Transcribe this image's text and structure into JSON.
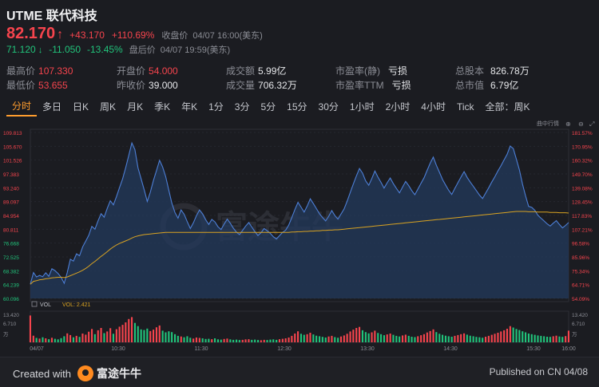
{
  "header": {
    "title": "UTME 联代科技",
    "price": "82.170",
    "change": "+43.170",
    "change_pct": "+110.69%",
    "close_label": "收盘价",
    "close_time": "04/07 16:00(美东)",
    "ah_price": "71.120",
    "ah_change": "-11.050",
    "ah_change_pct": "-13.45%",
    "ah_label": "盘后价",
    "ah_time": "04/07 19:59(美东)"
  },
  "stats": {
    "high_label": "最高价",
    "high": "107.330",
    "low_label": "最低价",
    "low": "53.655",
    "open_label": "开盘价",
    "open": "54.000",
    "prev_label": "昨收价",
    "prev": "39.000",
    "turnover_label": "成交额",
    "turnover": "5.99亿",
    "volume_label": "成交量",
    "volume": "706.32万",
    "pe_static_label": "市盈率(静)",
    "pe_static": "亏损",
    "pe_ttm_label": "市盈率TTM",
    "pe_ttm": "亏损",
    "shares_label": "总股本",
    "shares": "826.78万",
    "mktcap_label": "总市值",
    "mktcap": "6.79亿"
  },
  "tabs": [
    "分时",
    "多日",
    "日K",
    "周K",
    "月K",
    "季K",
    "年K",
    "1分",
    "3分",
    "5分",
    "15分",
    "30分",
    "1小时",
    "2小时",
    "4小时",
    "Tick",
    "全部：周K"
  ],
  "active_tab": 0,
  "chart_data": {
    "type": "line",
    "toolbar_label": "曲中行情",
    "watermark": "富途牛牛",
    "price_ticks": [
      "109.813",
      "105.670",
      "101.526",
      "97.383",
      "93.240",
      "89.097",
      "84.954",
      "80.811",
      "76.668",
      "72.525",
      "68.382",
      "64.239",
      "60.096"
    ],
    "pct_ticks": [
      "181.57%",
      "170.95%",
      "160.32%",
      "149.70%",
      "139.08%",
      "128.45%",
      "117.83%",
      "107.21%",
      "96.58%",
      "85.96%",
      "75.34%",
      "64.71%",
      "54.09%"
    ],
    "time_ticks": [
      "04/07",
      "10:30",
      "11:30",
      "12:30",
      "13:30",
      "14:30",
      "15:30",
      "16:00"
    ],
    "ylim": [
      58.0,
      110.5
    ],
    "vol_label": "VOL",
    "vol_value_label": "VOL: 2.421",
    "vol_ticks_left": [
      "13.420",
      "6.710",
      "万"
    ],
    "vol_ticks_right": [
      "13.420",
      "6.710",
      "万"
    ],
    "vol_max": 13.42,
    "colors": {
      "price_line": "#4d7fd6",
      "avg_line": "#d9a322",
      "up": "#f6444d",
      "down": "#21c47b",
      "fill": "#23395c"
    },
    "price": [
      62.5,
      66.2,
      64.8,
      65.3,
      64.9,
      66.1,
      65.0,
      67.4,
      66.8,
      65.9,
      64.7,
      62.8,
      66.2,
      70.4,
      69.8,
      72.1,
      71.5,
      74.3,
      76.1,
      78.0,
      80.8,
      79.9,
      82.5,
      84.8,
      83.7,
      86.5,
      88.9,
      87.6,
      90.2,
      93.1,
      95.8,
      99.4,
      103.2,
      107.2,
      105.1,
      99.3,
      95.8,
      92.4,
      88.7,
      91.6,
      95.3,
      98.4,
      101.7,
      99.6,
      96.5,
      92.3,
      88.1,
      85.2,
      83.4,
      86.0,
      84.6,
      82.3,
      80.1,
      81.9,
      84.2,
      86.0,
      84.7,
      82.9,
      81.4,
      83.0,
      82.2,
      80.7,
      79.8,
      81.5,
      83.1,
      81.8,
      80.2,
      79.0,
      78.2,
      79.5,
      80.9,
      82.0,
      80.6,
      79.1,
      77.9,
      78.8,
      80.1,
      79.4,
      78.6,
      77.5,
      76.8,
      77.9,
      78.9,
      79.6,
      81.2,
      83.6,
      86.1,
      88.4,
      86.9,
      85.3,
      87.2,
      89.5,
      88.0,
      86.4,
      84.8,
      83.6,
      82.5,
      84.0,
      85.8,
      84.2,
      83.1,
      84.7,
      86.3,
      88.8,
      91.5,
      94.2,
      96.8,
      99.1,
      97.6,
      95.2,
      93.8,
      95.9,
      98.3,
      96.4,
      94.7,
      92.9,
      94.6,
      96.1,
      94.3,
      92.8,
      91.4,
      93.2,
      95.0,
      93.7,
      92.1,
      90.8,
      92.6,
      94.4,
      96.2,
      98.5,
      100.8,
      102.7,
      100.1,
      97.9,
      95.6,
      93.9,
      92.2,
      90.9,
      92.8,
      94.6,
      96.4,
      98.1,
      96.3,
      94.8,
      93.5,
      92.1,
      90.7,
      89.6,
      91.3,
      93.0,
      94.8,
      96.5,
      98.3,
      100.0,
      101.8,
      103.6,
      106.2,
      105.4,
      102.1,
      98.6,
      94.2,
      90.4,
      87.1,
      86.8,
      85.9,
      84.3,
      83.4,
      82.5,
      81.6,
      80.9,
      81.8,
      82.6,
      81.4,
      80.3,
      81.1,
      82.0
    ],
    "avg": [
      62.5,
      63.4,
      63.6,
      63.9,
      64.0,
      64.2,
      64.3,
      64.5,
      64.6,
      64.7,
      64.7,
      64.6,
      64.8,
      65.2,
      65.6,
      66.0,
      66.4,
      66.9,
      67.5,
      68.2,
      69.0,
      69.7,
      70.5,
      71.3,
      72.0,
      72.8,
      73.6,
      74.3,
      74.9,
      75.4,
      75.8,
      76.2,
      76.6,
      77.1,
      77.5,
      77.8,
      78.0,
      78.2,
      78.3,
      78.4,
      78.5,
      78.6,
      78.7,
      78.8,
      78.9,
      78.9,
      78.9,
      78.9,
      78.9,
      78.9,
      78.9,
      78.9,
      78.9,
      78.9,
      78.9,
      78.9,
      78.9,
      78.9,
      78.9,
      78.9,
      78.9,
      78.9,
      78.9,
      78.9,
      78.9,
      78.9,
      78.9,
      78.9,
      78.9,
      78.9,
      78.9,
      78.9,
      78.9,
      78.9,
      78.9,
      78.9,
      78.9,
      78.9,
      78.9,
      78.9,
      78.9,
      78.9,
      78.9,
      78.9,
      78.9,
      79.0,
      79.0,
      79.1,
      79.1,
      79.2,
      79.2,
      79.3,
      79.3,
      79.4,
      79.4,
      79.5,
      79.5,
      79.6,
      79.6,
      79.7,
      79.7,
      79.8,
      79.9,
      80.0,
      80.1,
      80.2,
      80.3,
      80.4,
      80.5,
      80.6,
      80.7,
      80.8,
      80.9,
      81.0,
      81.1,
      81.2,
      81.3,
      81.4,
      81.5,
      81.6,
      81.7,
      81.8,
      81.9,
      82.0,
      82.1,
      82.2,
      82.3,
      82.4,
      82.5,
      82.6,
      82.7,
      82.8,
      82.9,
      83.0,
      83.1,
      83.2,
      83.3,
      83.4,
      83.5,
      83.6,
      83.7,
      83.8,
      83.9,
      84.0,
      84.1,
      84.2,
      84.3,
      84.4,
      84.5,
      84.6,
      84.7,
      84.8,
      84.9,
      85.0,
      85.1,
      85.2,
      85.3,
      85.4,
      85.5,
      85.5,
      85.5,
      85.5,
      85.4,
      85.4,
      85.4,
      85.3,
      85.3,
      85.3,
      85.3,
      85.2,
      85.2,
      85.2,
      85.1,
      85.1,
      85.1,
      85.0
    ],
    "volume": [
      12.9,
      3.2,
      2.1,
      1.8,
      2.4,
      1.9,
      1.5,
      2.2,
      1.7,
      1.4,
      2.0,
      2.9,
      4.3,
      3.5,
      2.4,
      3.1,
      2.6,
      4.2,
      3.7,
      5.1,
      6.4,
      3.9,
      5.8,
      6.9,
      4.4,
      5.2,
      6.8,
      4.1,
      6.3,
      7.5,
      8.4,
      9.6,
      11.2,
      12.1,
      9.3,
      7.8,
      6.2,
      5.9,
      6.6,
      5.4,
      6.1,
      7.2,
      8.1,
      5.6,
      4.8,
      5.3,
      4.9,
      3.9,
      3.1,
      2.8,
      2.4,
      2.9,
      2.2,
      1.8,
      2.3,
      2.1,
      1.9,
      1.6,
      1.7,
      1.5,
      1.9,
      1.4,
      1.3,
      1.6,
      1.8,
      1.4,
      1.2,
      1.3,
      1.1,
      1.2,
      1.4,
      1.5,
      1.2,
      1.3,
      1.1,
      1.0,
      1.2,
      1.1,
      1.3,
      1.4,
      1.2,
      1.5,
      1.7,
      1.9,
      2.3,
      3.1,
      4.2,
      5.3,
      4.1,
      3.6,
      3.9,
      4.6,
      3.8,
      3.2,
      2.9,
      2.6,
      2.3,
      2.8,
      3.1,
      2.5,
      2.2,
      2.8,
      3.3,
      4.1,
      5.2,
      6.1,
      6.9,
      7.4,
      5.8,
      4.9,
      4.3,
      4.8,
      5.6,
      4.5,
      3.9,
      3.4,
      3.8,
      4.2,
      3.6,
      3.1,
      2.8,
      3.3,
      3.7,
      3.1,
      2.7,
      2.5,
      2.9,
      3.4,
      3.9,
      4.7,
      5.4,
      6.2,
      4.9,
      4.1,
      3.6,
      3.2,
      2.9,
      2.7,
      3.1,
      3.5,
      3.9,
      4.3,
      3.7,
      3.2,
      2.9,
      2.6,
      2.4,
      2.2,
      2.7,
      3.1,
      3.6,
      4.1,
      4.6,
      5.2,
      5.8,
      6.5,
      7.8,
      7.1,
      6.4,
      5.9,
      5.3,
      4.8,
      4.2,
      3.9,
      3.6,
      3.3,
      3.1,
      2.9,
      2.7,
      2.6,
      2.9,
      3.2,
      2.8,
      2.6,
      3.0,
      5.6
    ]
  }
}
